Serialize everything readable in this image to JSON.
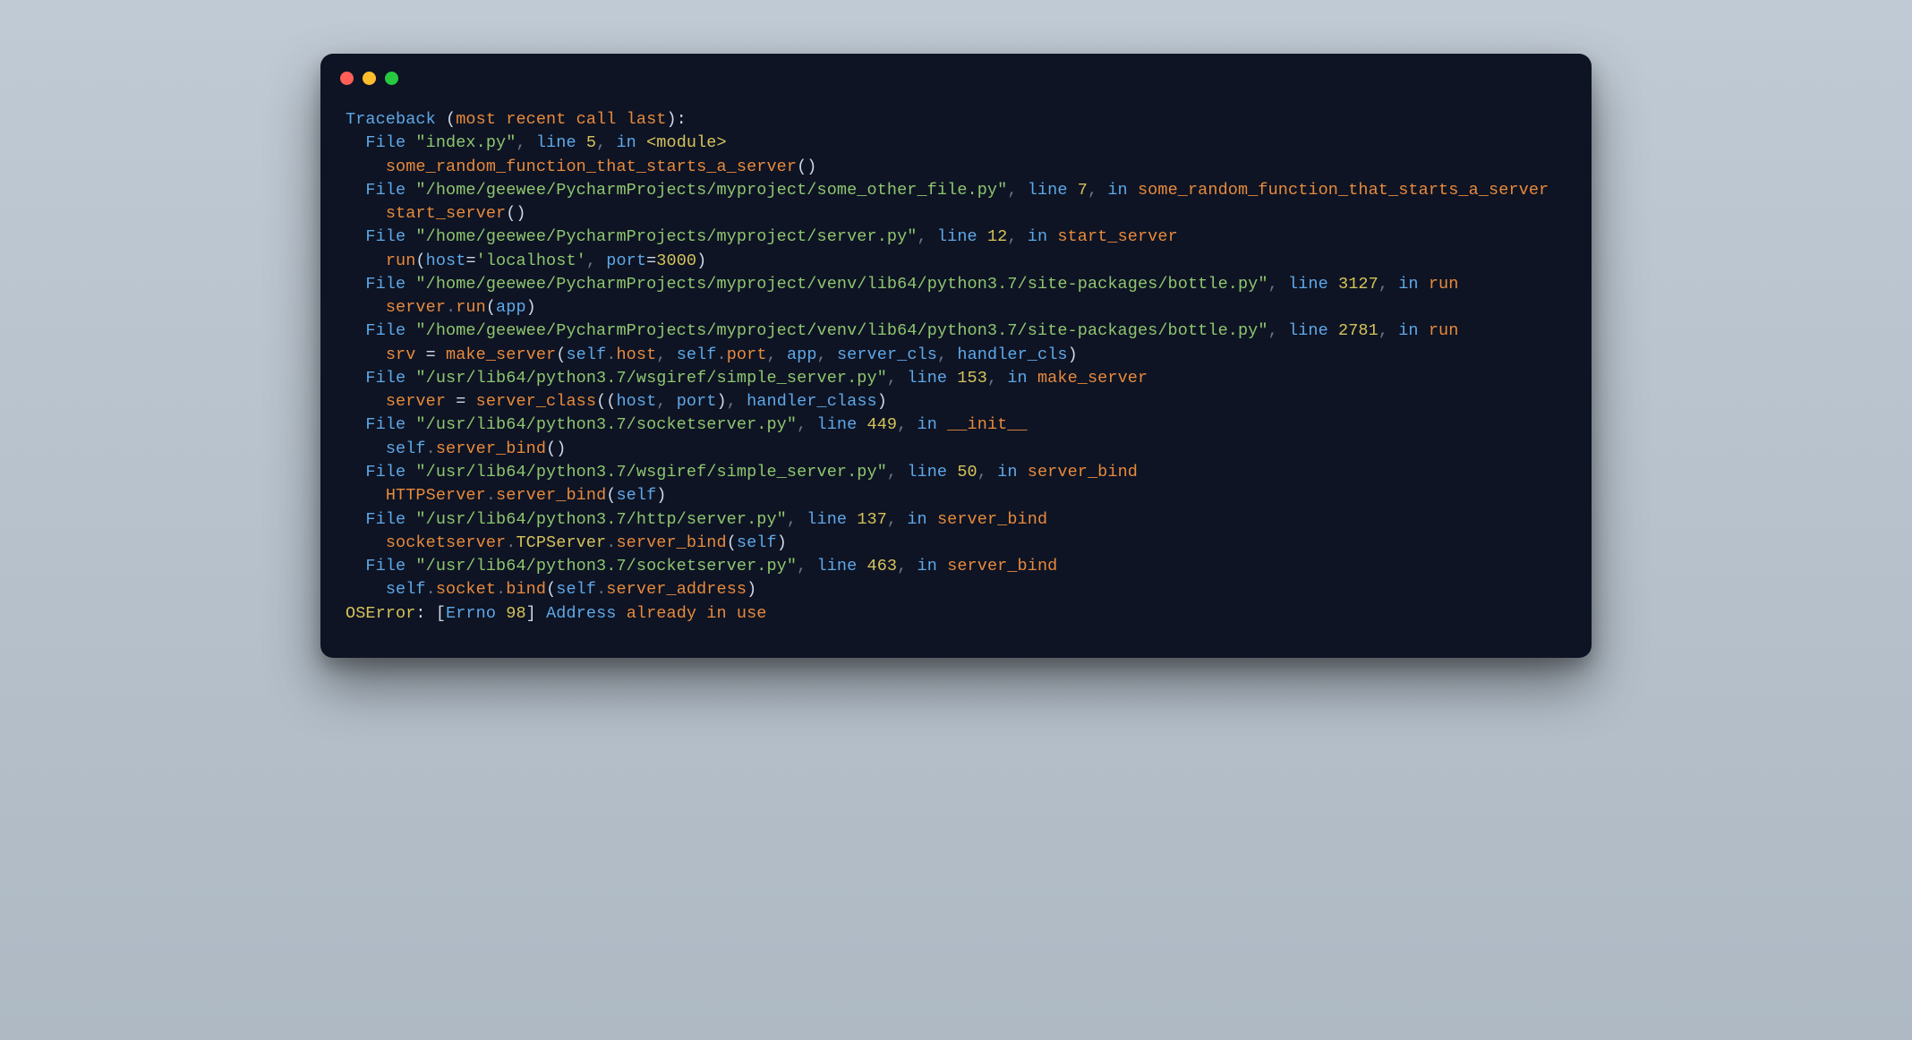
{
  "colors": {
    "bg_terminal": "#0e1424",
    "dot_red": "#ff5f56",
    "dot_yellow": "#ffbd2e",
    "dot_green": "#27c93f",
    "blue": "#5fa8e8",
    "orange": "#e88a3c",
    "green": "#8fc66f",
    "yellow": "#d6c35a",
    "gray": "#6b7687",
    "white": "#cfd8e6"
  },
  "traceback": {
    "header": "Traceback (most recent call last):",
    "header_prefix": "Traceback ",
    "header_paren": "(most recent call last):",
    "frames": [
      {
        "file": "index.py",
        "line": "5",
        "location": "<module>",
        "code": "some_random_function_that_starts_a_server()",
        "code_tokens": [
          {
            "t": "some_random_function_that_starts_a_server",
            "c": "orange"
          },
          {
            "t": "()",
            "c": "white"
          }
        ]
      },
      {
        "file": "/home/geewee/PycharmProjects/myproject/some_other_file.py",
        "line": "7",
        "location": "some_random_function_that_starts_a_server",
        "code": "start_server()",
        "code_tokens": [
          {
            "t": "start_server",
            "c": "orange"
          },
          {
            "t": "()",
            "c": "white"
          }
        ]
      },
      {
        "file": "/home/geewee/PycharmProjects/myproject/server.py",
        "line": "12",
        "location": "start_server",
        "code": "run(host='localhost', port=3000)",
        "code_tokens": [
          {
            "t": "run",
            "c": "orange"
          },
          {
            "t": "(",
            "c": "white"
          },
          {
            "t": "host",
            "c": "blue"
          },
          {
            "t": "=",
            "c": "white"
          },
          {
            "t": "'localhost'",
            "c": "green"
          },
          {
            "t": ", ",
            "c": "gray"
          },
          {
            "t": "port",
            "c": "blue"
          },
          {
            "t": "=",
            "c": "white"
          },
          {
            "t": "3000",
            "c": "yellow"
          },
          {
            "t": ")",
            "c": "white"
          }
        ]
      },
      {
        "file": "/home/geewee/PycharmProjects/myproject/venv/lib64/python3.7/site-packages/bottle.py",
        "line": "3127",
        "location": "run",
        "code": "server.run(app)",
        "code_tokens": [
          {
            "t": "server",
            "c": "orange"
          },
          {
            "t": ".",
            "c": "gray"
          },
          {
            "t": "run",
            "c": "orange"
          },
          {
            "t": "(",
            "c": "white"
          },
          {
            "t": "app",
            "c": "blue"
          },
          {
            "t": ")",
            "c": "white"
          }
        ]
      },
      {
        "file": "/home/geewee/PycharmProjects/myproject/venv/lib64/python3.7/site-packages/bottle.py",
        "line": "2781",
        "location": "run",
        "code": "srv = make_server(self.host, self.port, app, server_cls, handler_cls)",
        "code_tokens": [
          {
            "t": "srv ",
            "c": "orange"
          },
          {
            "t": "= ",
            "c": "white"
          },
          {
            "t": "make_server",
            "c": "orange"
          },
          {
            "t": "(",
            "c": "white"
          },
          {
            "t": "self",
            "c": "blue"
          },
          {
            "t": ".",
            "c": "gray"
          },
          {
            "t": "host",
            "c": "orange"
          },
          {
            "t": ", ",
            "c": "gray"
          },
          {
            "t": "self",
            "c": "blue"
          },
          {
            "t": ".",
            "c": "gray"
          },
          {
            "t": "port",
            "c": "orange"
          },
          {
            "t": ", ",
            "c": "gray"
          },
          {
            "t": "app",
            "c": "blue"
          },
          {
            "t": ", ",
            "c": "gray"
          },
          {
            "t": "server_cls",
            "c": "blue"
          },
          {
            "t": ", ",
            "c": "gray"
          },
          {
            "t": "handler_cls",
            "c": "blue"
          },
          {
            "t": ")",
            "c": "white"
          }
        ]
      },
      {
        "file": "/usr/lib64/python3.7/wsgiref/simple_server.py",
        "line": "153",
        "location": "make_server",
        "code": "server = server_class((host, port), handler_class)",
        "code_tokens": [
          {
            "t": "server ",
            "c": "orange"
          },
          {
            "t": "= ",
            "c": "white"
          },
          {
            "t": "server_class",
            "c": "orange"
          },
          {
            "t": "((",
            "c": "white"
          },
          {
            "t": "host",
            "c": "blue"
          },
          {
            "t": ", ",
            "c": "gray"
          },
          {
            "t": "port",
            "c": "blue"
          },
          {
            "t": ")",
            "c": "white"
          },
          {
            "t": ", ",
            "c": "gray"
          },
          {
            "t": "handler_class",
            "c": "blue"
          },
          {
            "t": ")",
            "c": "white"
          }
        ]
      },
      {
        "file": "/usr/lib64/python3.7/socketserver.py",
        "line": "449",
        "location": "__init__",
        "code": "self.server_bind()",
        "code_tokens": [
          {
            "t": "self",
            "c": "blue"
          },
          {
            "t": ".",
            "c": "gray"
          },
          {
            "t": "server_bind",
            "c": "orange"
          },
          {
            "t": "()",
            "c": "white"
          }
        ]
      },
      {
        "file": "/usr/lib64/python3.7/wsgiref/simple_server.py",
        "line": "50",
        "location": "server_bind",
        "code": "HTTPServer.server_bind(self)",
        "code_tokens": [
          {
            "t": "HTTPServer",
            "c": "orange"
          },
          {
            "t": ".",
            "c": "gray"
          },
          {
            "t": "server_bind",
            "c": "orange"
          },
          {
            "t": "(",
            "c": "white"
          },
          {
            "t": "self",
            "c": "blue"
          },
          {
            "t": ")",
            "c": "white"
          }
        ]
      },
      {
        "file": "/usr/lib64/python3.7/http/server.py",
        "line": "137",
        "location": "server_bind",
        "code": "socketserver.TCPServer.server_bind(self)",
        "code_tokens": [
          {
            "t": "socketserver",
            "c": "orange"
          },
          {
            "t": ".",
            "c": "gray"
          },
          {
            "t": "TCPServer",
            "c": "yellow"
          },
          {
            "t": ".",
            "c": "gray"
          },
          {
            "t": "server_bind",
            "c": "orange"
          },
          {
            "t": "(",
            "c": "white"
          },
          {
            "t": "self",
            "c": "blue"
          },
          {
            "t": ")",
            "c": "white"
          }
        ]
      },
      {
        "file": "/usr/lib64/python3.7/socketserver.py",
        "line": "463",
        "location": "server_bind",
        "code": "self.socket.bind(self.server_address)",
        "code_tokens": [
          {
            "t": "self",
            "c": "blue"
          },
          {
            "t": ".",
            "c": "gray"
          },
          {
            "t": "socket",
            "c": "orange"
          },
          {
            "t": ".",
            "c": "gray"
          },
          {
            "t": "bind",
            "c": "orange"
          },
          {
            "t": "(",
            "c": "white"
          },
          {
            "t": "self",
            "c": "blue"
          },
          {
            "t": ".",
            "c": "gray"
          },
          {
            "t": "server_address",
            "c": "orange"
          },
          {
            "t": ")",
            "c": "white"
          }
        ]
      }
    ],
    "error": {
      "type": "OSError",
      "errno_label": "Errno",
      "errno": "98",
      "msg_prefix": "Address ",
      "msg_rest": "already in use",
      "raw": "OSError: [Errno 98] Address already in use"
    },
    "labels": {
      "file": "File",
      "line": "line",
      "in": "in"
    }
  }
}
